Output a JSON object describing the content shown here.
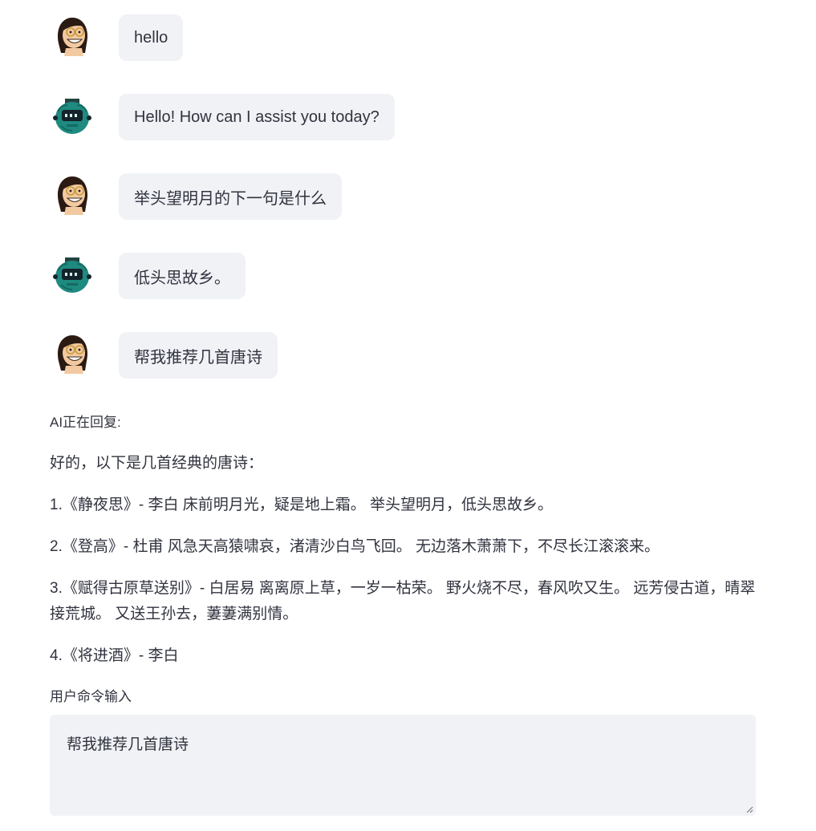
{
  "messages": [
    {
      "role": "user",
      "avatar_icon": "woman-glasses-avatar-icon",
      "text": "hello"
    },
    {
      "role": "assistant",
      "avatar_icon": "robot-avatar-icon",
      "text": "Hello! How can I assist you today?"
    },
    {
      "role": "user",
      "avatar_icon": "woman-glasses-avatar-icon",
      "text": "举头望明月的下一句是什么"
    },
    {
      "role": "assistant",
      "avatar_icon": "robot-avatar-icon",
      "text": "低头思故乡。"
    },
    {
      "role": "user",
      "avatar_icon": "woman-glasses-avatar-icon",
      "text": "帮我推荐几首唐诗"
    }
  ],
  "streaming": {
    "status": "AI正在回复:",
    "paragraphs": [
      "好的，以下是几首经典的唐诗：",
      "1.《静夜思》- 李白 床前明月光，疑是地上霜。 举头望明月，低头思故乡。",
      "2.《登高》- 杜甫 风急天高猿啸哀，渚清沙白鸟飞回。 无边落木萧萧下，不尽长江滚滚来。",
      "3.《赋得古原草送别》- 白居易 离离原上草，一岁一枯荣。 野火烧不尽，春风吹又生。 远芳侵古道，晴翠接荒城。 又送王孙去，萋萋满别情。",
      "4.《将进酒》- 李白"
    ]
  },
  "input": {
    "label": "用户命令输入",
    "value": "帮我推荐几首唐诗"
  },
  "colors": {
    "bubble_bg": "#f0f2f6",
    "text": "#31333f",
    "robot_teal": "#1e8a80"
  }
}
